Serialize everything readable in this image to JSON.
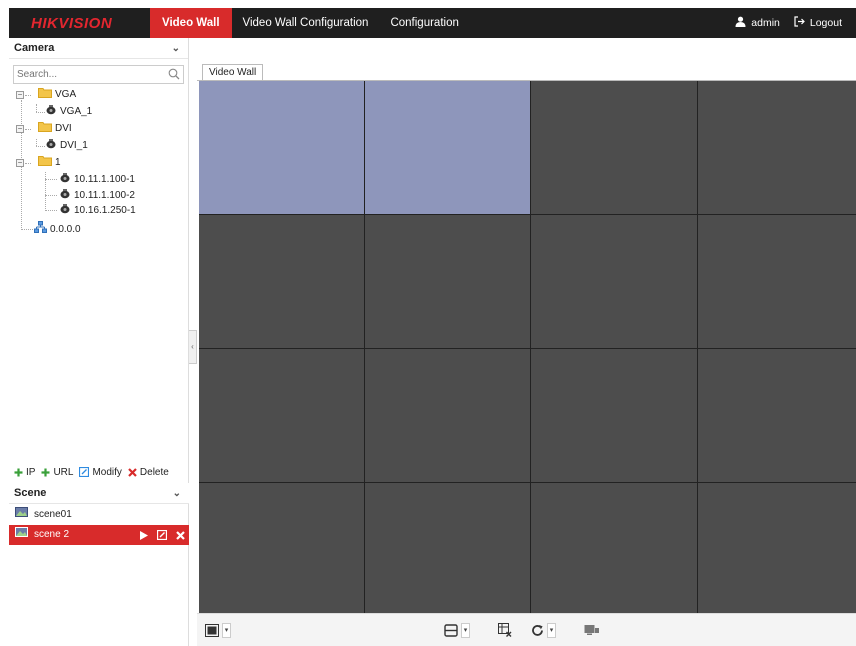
{
  "app": {
    "brand": "HIKVISION",
    "nav": [
      {
        "label": "Video Wall",
        "active": true
      },
      {
        "label": "Video Wall Configuration",
        "active": false
      },
      {
        "label": "Configuration",
        "active": false
      }
    ],
    "user": "admin",
    "logout": "Logout"
  },
  "camera_panel": {
    "title": "Camera",
    "search_placeholder": "Search...",
    "tree": {
      "vga": "VGA",
      "vga_1": "VGA_1",
      "dvi": "DVI",
      "dvi_1": "DVI_1",
      "group_1": "1",
      "cam1": "10.11.1.100-1",
      "cam2": "10.11.1.100-2",
      "cam3": "10.16.1.250-1",
      "net": "0.0.0.0"
    },
    "actions": {
      "ip": "IP",
      "url": "URL",
      "modify": "Modify",
      "delete": "Delete"
    }
  },
  "scene_panel": {
    "title": "Scene",
    "items": [
      {
        "label": "scene01",
        "active": false
      },
      {
        "label": "scene 2",
        "active": true
      }
    ]
  },
  "main": {
    "tab": "Video Wall",
    "grid": {
      "rows": 4,
      "cols": 4,
      "selected_cells": [
        0,
        1
      ]
    }
  },
  "colors": {
    "accent": "#d82b2b",
    "topbar": "#1f1f1f",
    "cell": "#4d4d4d",
    "cell_selected": "#8e96bb"
  }
}
